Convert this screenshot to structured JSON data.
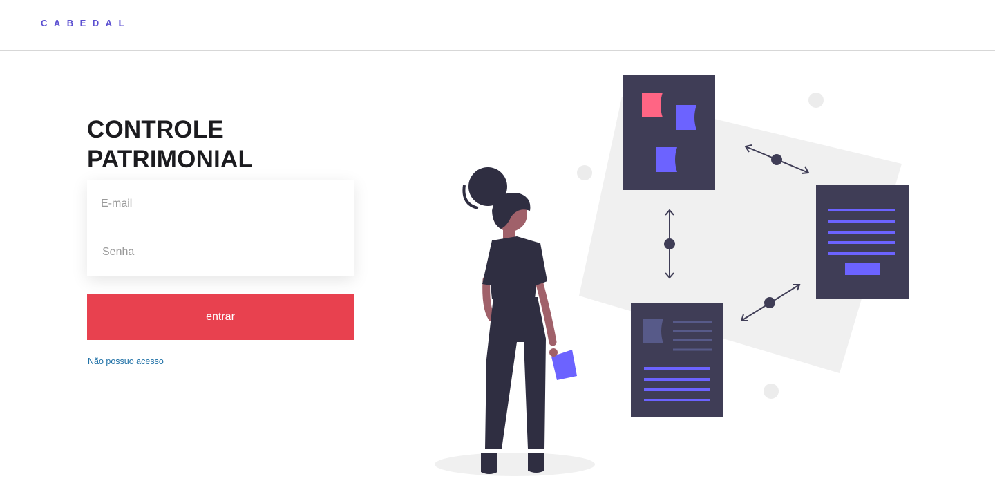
{
  "header": {
    "logo": "CABEDAL"
  },
  "main": {
    "title_line1": "CONTROLE",
    "title_line2": "PATRIMONIAL",
    "email_placeholder": "E-mail",
    "password_placeholder": "Senha",
    "submit_label": "entrar",
    "no_access_link": "Não possuo acesso"
  },
  "colors": {
    "brand": "#5b4fd1",
    "primary_button": "#e8414f",
    "link": "#1d6fa5",
    "illustration_dark": "#3f3d56",
    "illustration_accent": "#6c63ff",
    "illustration_pink": "#ff6584"
  }
}
